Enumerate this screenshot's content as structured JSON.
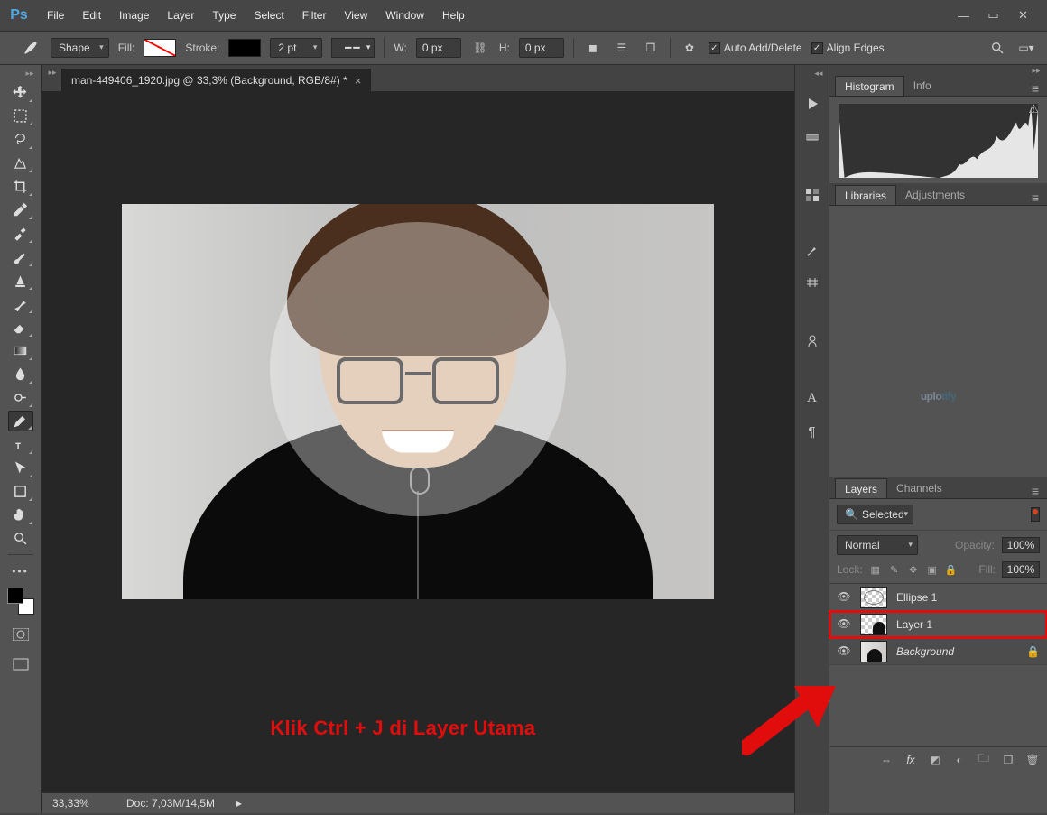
{
  "app": {
    "logo_text": "Ps"
  },
  "menu": [
    "File",
    "Edit",
    "Image",
    "Layer",
    "Type",
    "Select",
    "Filter",
    "View",
    "Window",
    "Help"
  ],
  "options": {
    "shape_mode": "Shape",
    "fill_label": "Fill:",
    "stroke_label": "Stroke:",
    "stroke_width": "2 pt",
    "w_label": "W:",
    "w_value": "0 px",
    "h_label": "H:",
    "h_value": "0 px",
    "auto_add_delete": "Auto Add/Delete",
    "align_edges": "Align Edges",
    "checked_mark": "✓"
  },
  "document": {
    "tab_title": "man-449406_1920.jpg @ 33,3% (Background, RGB/8#) *"
  },
  "status": {
    "zoom": "33,33%",
    "doc_info": "Doc: 7,03M/14,5M"
  },
  "panels": {
    "histogram_tab": "Histogram",
    "info_tab": "Info",
    "libraries_tab": "Libraries",
    "adjustments_tab": "Adjustments",
    "layers_tab": "Layers",
    "channels_tab": "Channels"
  },
  "watermark": {
    "a": "uplo",
    "b": "tify"
  },
  "layers_panel": {
    "filter_label": "Selected",
    "blend_mode": "Normal",
    "opacity_label": "Opacity:",
    "opacity_value": "100%",
    "lock_label": "Lock:",
    "fill_label": "Fill:",
    "fill_value": "100%",
    "layers": [
      {
        "name": "Ellipse 1",
        "locked": false,
        "thumb": "shape"
      },
      {
        "name": "Layer 1",
        "locked": false,
        "thumb": "checker-photo"
      },
      {
        "name": "Background",
        "locked": true,
        "thumb": "photo"
      }
    ]
  },
  "annotation": {
    "text": "Klik Ctrl + J di Layer Utama"
  }
}
